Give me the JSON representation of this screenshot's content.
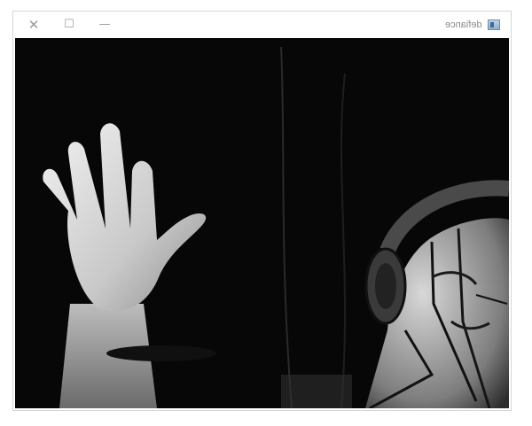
{
  "window": {
    "title": "defiance",
    "controls": {
      "close_glyph": "✕",
      "maximize_glyph": "☐",
      "minimize_glyph": "—"
    }
  },
  "icons": {
    "app": "app-window-icon",
    "close": "close-icon",
    "maximize": "maximize-icon",
    "minimize": "minimize-icon"
  },
  "video": {
    "description_hidden": ""
  }
}
